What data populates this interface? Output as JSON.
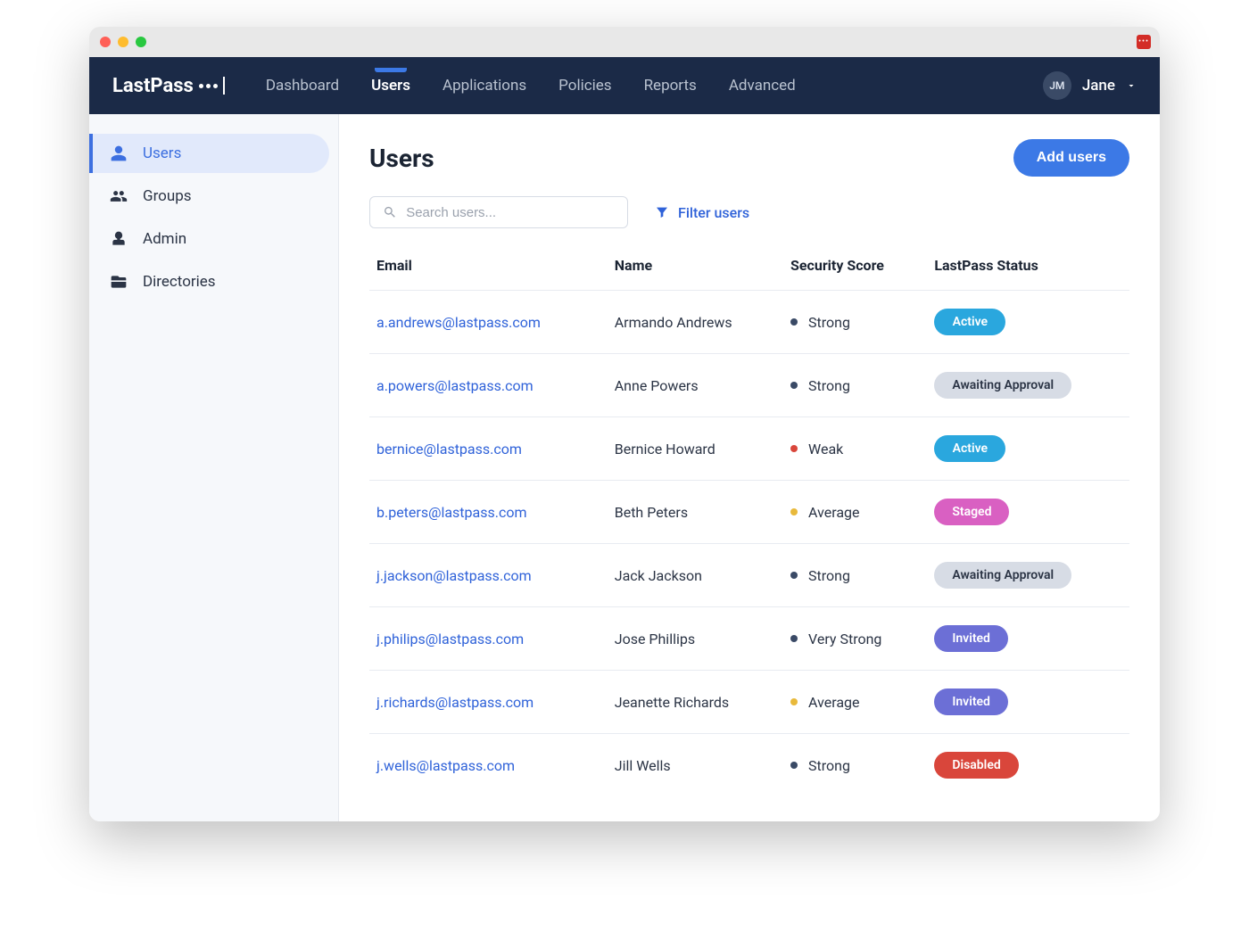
{
  "brand": "LastPass",
  "nav": {
    "items": [
      "Dashboard",
      "Users",
      "Applications",
      "Policies",
      "Reports",
      "Advanced"
    ],
    "active_index": 1
  },
  "user": {
    "initials": "JM",
    "name": "Jane"
  },
  "sidebar": {
    "items": [
      {
        "label": "Users",
        "icon": "user"
      },
      {
        "label": "Groups",
        "icon": "group"
      },
      {
        "label": "Admin",
        "icon": "admin"
      },
      {
        "label": "Directories",
        "icon": "directory"
      }
    ],
    "active_index": 0
  },
  "page": {
    "title": "Users",
    "add_button": "Add users",
    "search_placeholder": "Search users...",
    "filter_label": "Filter users"
  },
  "columns": [
    "Email",
    "Name",
    "Security Score",
    "LastPass Status"
  ],
  "score_colors": {
    "Strong": "#3a4a66",
    "Very Strong": "#3a4a66",
    "Weak": "#d9463b",
    "Average": "#e8b93b"
  },
  "status_colors": {
    "Active": "#2aa7de",
    "Awaiting Approval": "gray",
    "Staged": "#d960c2",
    "Invited": "#6c6fd6",
    "Disabled": "#d9463b"
  },
  "rows": [
    {
      "email": "a.andrews@lastpass.com",
      "name": "Armando Andrews",
      "score": "Strong",
      "status": "Active"
    },
    {
      "email": "a.powers@lastpass.com",
      "name": "Anne Powers",
      "score": "Strong",
      "status": "Awaiting Approval"
    },
    {
      "email": "bernice@lastpass.com",
      "name": "Bernice Howard",
      "score": "Weak",
      "status": "Active"
    },
    {
      "email": "b.peters@lastpass.com",
      "name": "Beth Peters",
      "score": "Average",
      "status": "Staged"
    },
    {
      "email": "j.jackson@lastpass.com",
      "name": "Jack Jackson",
      "score": "Strong",
      "status": "Awaiting Approval"
    },
    {
      "email": "j.philips@lastpass.com",
      "name": "Jose Phillips",
      "score": "Very Strong",
      "status": "Invited"
    },
    {
      "email": "j.richards@lastpass.com",
      "name": "Jeanette Richards",
      "score": "Average",
      "status": "Invited"
    },
    {
      "email": "j.wells@lastpass.com",
      "name": "Jill Wells",
      "score": "Strong",
      "status": "Disabled"
    }
  ]
}
